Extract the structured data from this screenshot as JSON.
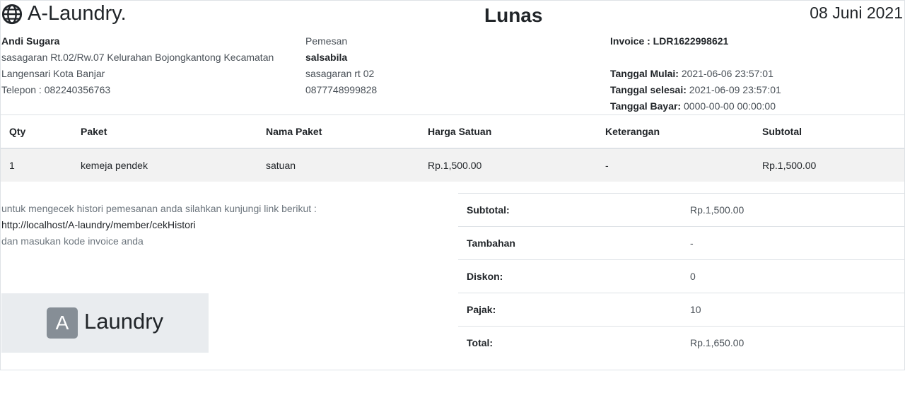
{
  "header": {
    "brand": "A-Laundry.",
    "brand_icon": "globe-icon",
    "status": "Lunas",
    "date": "08 Juni 2021"
  },
  "owner": {
    "name": "Andi Sugara",
    "address_line1": "sasagaran Rt.02/Rw.07 Kelurahan Bojongkantong Kecamatan",
    "address_line2": "Langensari Kota Banjar",
    "phone": "Telepon : 082240356763"
  },
  "customer": {
    "label": "Pemesan",
    "name": "salsabila",
    "address": "sasagaran rt 02",
    "phone": "0877748999828"
  },
  "invoice": {
    "number": "Invoice : LDR1622998621",
    "start_label": "Tanggal Mulai:",
    "start_value": "2021-06-06 23:57:01",
    "end_label": "Tanggal selesai:",
    "end_value": "2021-06-09 23:57:01",
    "paid_label": "Tanggal Bayar:",
    "paid_value": "0000-00-00 00:00:00"
  },
  "items": {
    "headers": [
      "Qty",
      "Paket",
      "Nama Paket",
      "Harga Satuan",
      "Keterangan",
      "Subtotal"
    ],
    "rows": [
      [
        "1",
        "kemeja pendek",
        "satuan",
        "Rp.1,500.00",
        "-",
        "Rp.1,500.00"
      ]
    ]
  },
  "note": {
    "line1": "untuk mengecek histori pemesanan anda silahkan kunjungi link berikut :",
    "link": "http://localhost/A-laundry/member/cekHistori",
    "line3": "dan masukan kode invoice anda"
  },
  "logo": {
    "mark": "A",
    "text": "Laundry"
  },
  "totals": [
    {
      "label": "Subtotal:",
      "value": "Rp.1,500.00"
    },
    {
      "label": "Tambahan",
      "value": "-"
    },
    {
      "label": "Diskon:",
      "value": "0"
    },
    {
      "label": "Pajak:",
      "value": "10"
    },
    {
      "label": "Total:",
      "value": "Rp.1,650.00"
    }
  ]
}
